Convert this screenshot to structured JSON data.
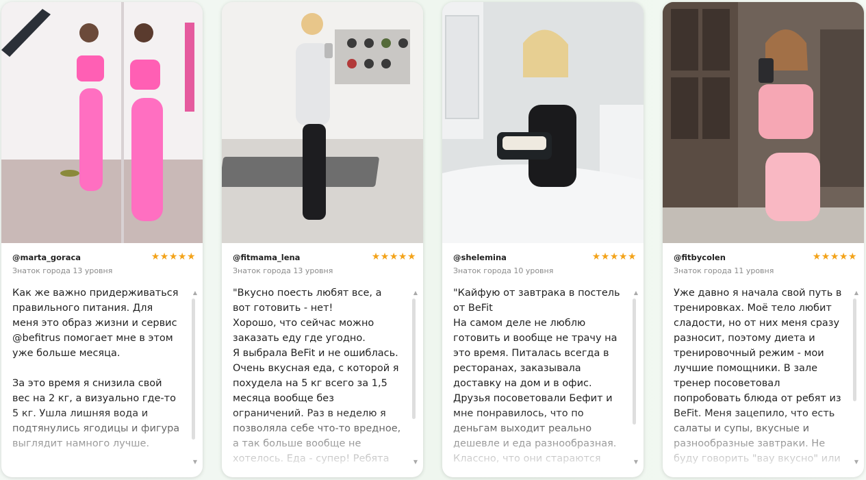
{
  "colors": {
    "star": "#f3a31a",
    "text": "#222222",
    "muted": "#8a8a8a",
    "card_bg": "#ffffff"
  },
  "reviews": [
    {
      "handle": "@marta_goraca",
      "level": "Знаток города 13 уровня",
      "stars": "★★★★★",
      "rating": 5,
      "text": "Как же важно придерживаться правильного питания. Для меня это образ жизни и сервис @befitrus помогает мне в этом уже больше месяца.\n\nЗа это время я снизила свой вес на 2 кг, а визуально где-то 5 кг. Ушла лишняя вода и подтянулись ягодицы и фигура выглядит намного лучше.",
      "scroll_arrow_up": "▲",
      "scroll_arrow_down": "▼"
    },
    {
      "handle": "@fitmama_lena",
      "level": "Знаток города 13 уровня",
      "stars": "★★★★★",
      "rating": 5,
      "text": "\"Вкусно поесть любят все, а вот готовить - нет!\nХорошо, что сейчас можно заказать еду где угодно.\nЯ выбрала BeFit и не ошиблась.\nОчень вкусная еда, с которой я похудела на 5 кг всего за 1,5 месяца вообще без ограничений. Раз в неделю я позволяла себе что-то вредное, а так больше вообще не хотелось. Еда - супер! Ребята",
      "scroll_arrow_up": "▲",
      "scroll_arrow_down": "▼"
    },
    {
      "handle": "@shelemina",
      "level": "Знаток города 10 уровня",
      "stars": "★★★★★",
      "rating": 5,
      "text": "\"Кайфую от завтрака в постель от BeFit\nНа самом деле не люблю готовить и вообще не трачу на это время. Питалась всегда в ресторанах, заказывала доставку на дом и в офис.\nДрузья посоветовали Бефит и мне понравилось, что по деньгам выходит реально дешевле и еда разнообразная. Классно, что они стараются",
      "scroll_arrow_up": "▲",
      "scroll_arrow_down": "▼"
    },
    {
      "handle": "@fitbycolen",
      "level": "Знаток города 11 уровня",
      "stars": "★★★★★",
      "rating": 5,
      "text": "Уже давно я начала свой путь в тренировках. Моё тело любит сладости, но от них меня сразу разносит, поэтому диета и тренировочный режим - мои лучшие помощники. В зале тренер посоветовал попробовать блюда от ребят из BeFit. Меня зацепило, что есть салаты и супы, вкусные и разнообразные завтраки. Не буду говорить \"вау вкусно\" или",
      "scroll_arrow_up": "▲",
      "scroll_arrow_down": "▼"
    }
  ]
}
